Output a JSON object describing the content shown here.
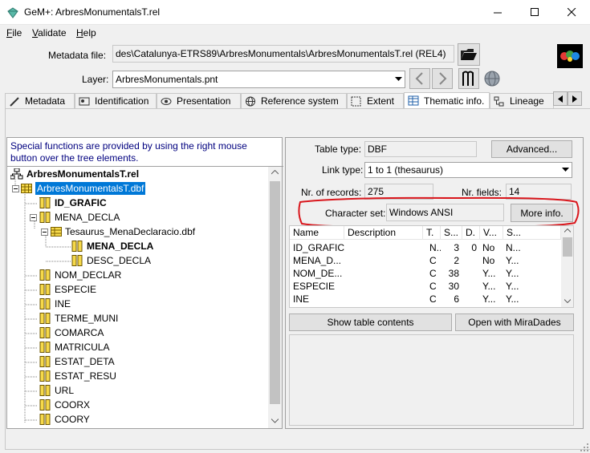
{
  "window": {
    "title": "GeM+: ArbresMonumentalsT.rel"
  },
  "menu": {
    "file": "File",
    "validate": "Validate",
    "help": "Help",
    "file_key": "F",
    "file_rest": "ile",
    "validate_key": "V",
    "validate_rest": "alidate",
    "help_key": "H",
    "help_rest": "elp"
  },
  "metadata_file": {
    "label": "Metadata file:",
    "value": "des\\Catalunya-ETRS89\\ArbresMonumentals\\ArbresMonumentalsT.rel (REL4)"
  },
  "layer": {
    "label": "Layer:",
    "value": "ArbresMonumentals.pnt"
  },
  "tabs": [
    "Metadata",
    "Identification",
    "Presentation",
    "Reference system",
    "Extent",
    "Thematic info.",
    "Lineage"
  ],
  "tree": {
    "hint": "Special functions are provided by using the right mouse button over the tree elements.",
    "root": "ArbresMonumentalsT.rel",
    "dbf": "ArbresMonumentalsT.dbf",
    "fields": [
      "ID_GRAFIC",
      "MENA_DECLA",
      "Tesaurus_MenaDeclaracio.dbf",
      "MENA_DECLA",
      "DESC_DECLA",
      "NOM_DECLAR",
      "ESPECIE",
      "INE",
      "TERME_MUNI",
      "COMARCA",
      "MATRICULA",
      "ESTAT_DETA",
      "ESTAT_RESU",
      "URL",
      "COORX",
      "COORY"
    ]
  },
  "thematic": {
    "table_type_label": "Table type:",
    "table_type": "DBF",
    "advanced_button": "Advanced...",
    "link_type_label": "Link type:",
    "link_type": "1 to 1 (thesaurus)",
    "nrecords_label": "Nr. of records:",
    "nrecords": "275",
    "nfields_label": "Nr. fields:",
    "nfields": "14",
    "charset_label": "Character set:",
    "charset": "Windows ANSI",
    "more_info_button": "More info.",
    "columns": [
      "Name",
      "Description",
      "T.",
      "S...",
      "D.",
      "V...",
      "S..."
    ],
    "rows": [
      [
        "ID_GRAFIC",
        "",
        "N..",
        "3",
        "0",
        "No",
        "N..."
      ],
      [
        "MENA_D...",
        "",
        "C",
        "2",
        "",
        "No",
        "Y..."
      ],
      [
        "NOM_DE...",
        "",
        "C",
        "38",
        "",
        "Y...",
        "Y..."
      ],
      [
        "ESPECIE",
        "",
        "C",
        "30",
        "",
        "Y...",
        "Y..."
      ],
      [
        "INE",
        "",
        "C",
        "6",
        "",
        "Y...",
        "Y..."
      ]
    ],
    "show_table_button": "Show table contents",
    "open_miradades_button": "Open with MiraDades"
  },
  "colors": {
    "highlight_ring": "#d9161c",
    "selection": "#0078d7",
    "hint_text": "#00007f"
  }
}
